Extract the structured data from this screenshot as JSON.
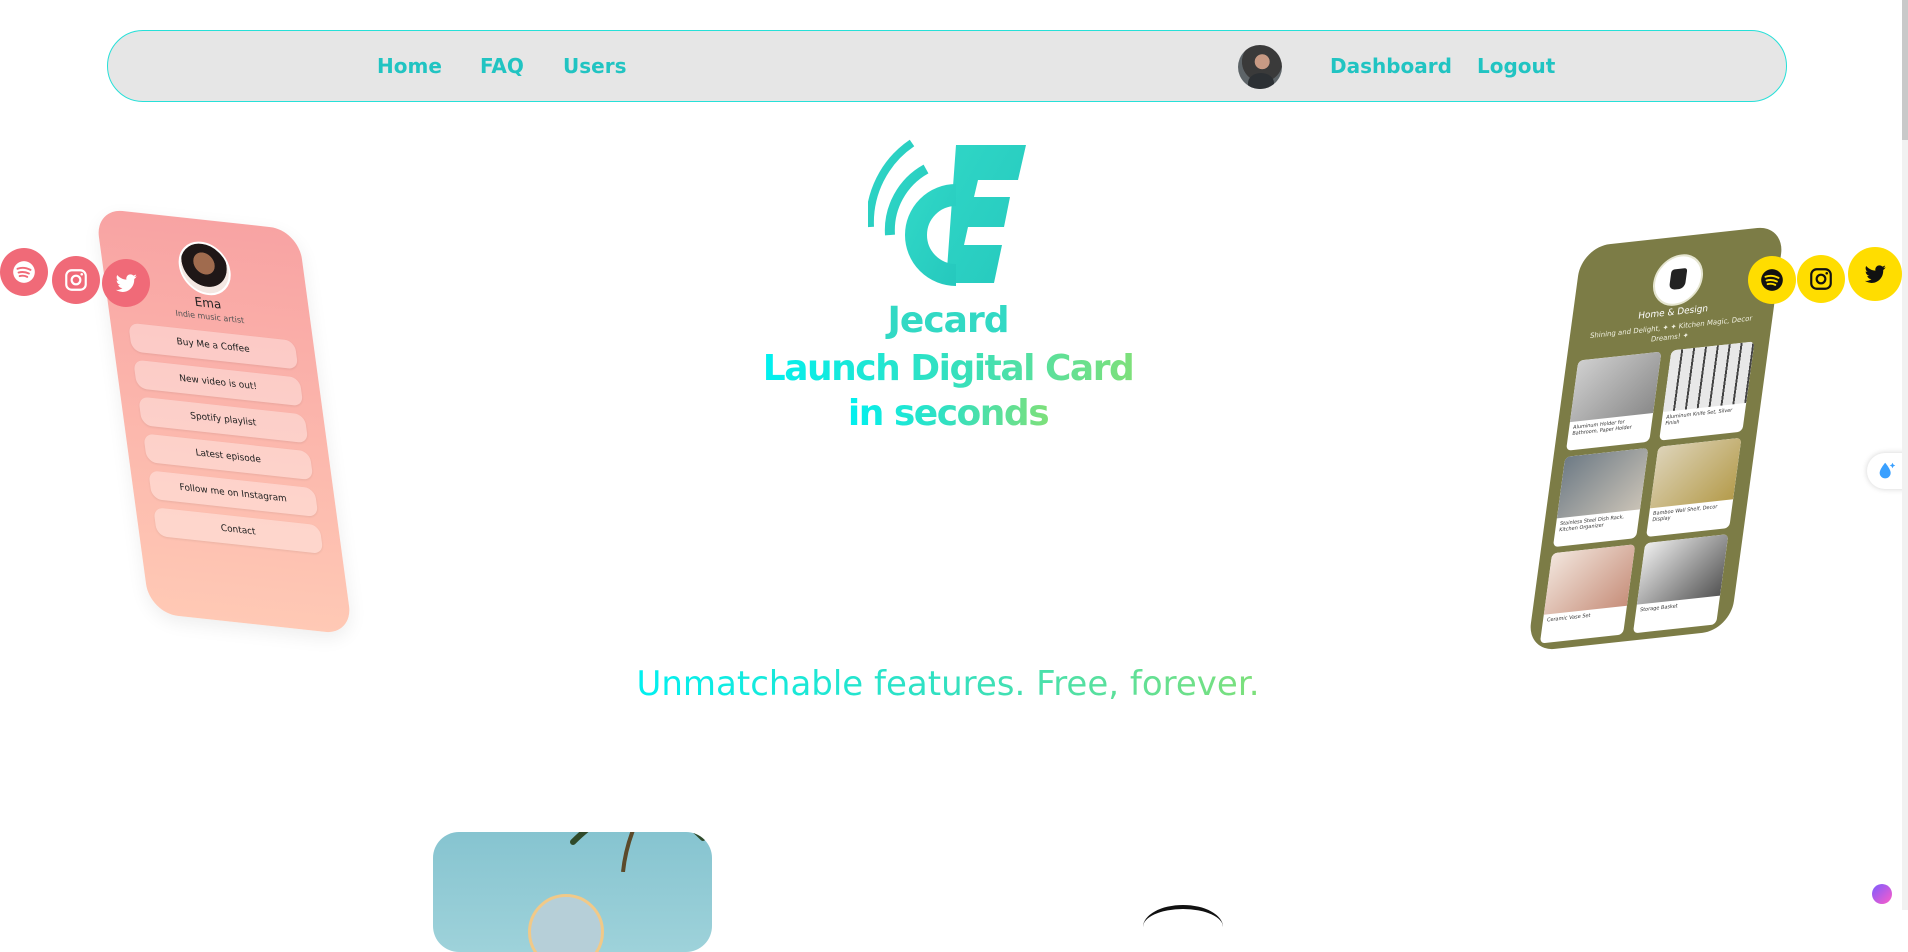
{
  "nav": {
    "home": "Home",
    "faq": "FAQ",
    "users": "Users",
    "dashboard": "Dashboard",
    "logout": "Logout"
  },
  "hero": {
    "brand": "Jecard",
    "headline_line1": "Launch Digital Card",
    "headline_line2": "in seconds",
    "tagline": "Unmatchable features. Free, forever."
  },
  "left_card": {
    "name": "Ema",
    "subtitle": "Indie music artist",
    "buttons": [
      "Buy Me a Coffee",
      "New video is out!",
      "Spotify playlist",
      "Latest episode",
      "Follow me on Instagram",
      "Contact"
    ]
  },
  "right_card": {
    "name": "Home & Design",
    "subtitle": "Shining and Delight, ✦ ✦ Kitchen Magic, Decor Dreams! ✦",
    "tiles": [
      {
        "caption": "Aluminum Holder for Bathroom, Paper Holder"
      },
      {
        "caption": "Aluminum Knife Set, Silver Finish"
      },
      {
        "caption": "Stainless Steel Dish Rack, Kitchen Organizer"
      },
      {
        "caption": "Bamboo Wall Shelf, Decor Display"
      },
      {
        "caption": "Ceramic Vase Set"
      },
      {
        "caption": "Storage Basket"
      }
    ]
  },
  "colors": {
    "accent": "#21c4c2",
    "left_card_social": "#f06a78",
    "right_card_social": "#ffdd00",
    "right_card_bg": "#7c7c46"
  },
  "icons": {
    "left_social": [
      "spotify-icon",
      "instagram-icon",
      "twitter-icon"
    ],
    "right_social": [
      "spotify-icon",
      "instagram-icon",
      "twitter-icon"
    ]
  }
}
